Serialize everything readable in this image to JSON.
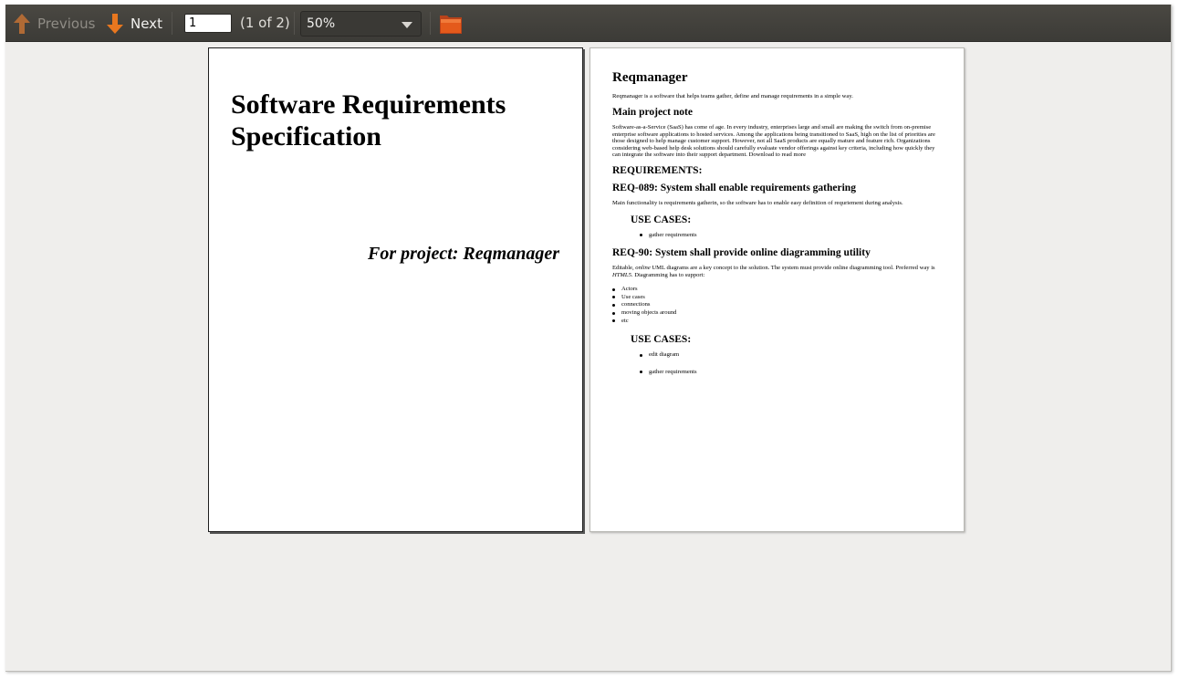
{
  "toolbar": {
    "previous_label": "Previous",
    "next_label": "Next",
    "page_input_value": "1",
    "page_count": "(1 of 2)",
    "zoom_value": "50%",
    "icons": {
      "previous": "up-arrow-icon",
      "next": "down-arrow-icon",
      "open": "folder-icon",
      "zoom": "chevron-down-icon"
    },
    "colors": {
      "arrow": "#e8771f",
      "arrow_disabled": "#b06a35",
      "folder": "#e45a1b"
    }
  },
  "page1": {
    "title": "Software Requirements Specification",
    "subtitle": "For project: Reqmanager"
  },
  "page2": {
    "title": "Reqmanager",
    "intro": "Reqmanager is a software that helps teams gather, define and manage requirements in a simple way.",
    "note_heading": "Main project note",
    "note_text": "Software-as-a-Service (SaaS) has come of age. In every industry, enterprises large and small are making the switch from on-premise enterprise software applications to hosted services. Among the applications being transitioned to SaaS, high on the list of priorities are those designed to help manage customer support. However, not all SaaS products are equally mature and feature rich. Organizations considering web-based help desk solutions should carefully evaluate vendor offerings against key criteria, including how quickly they can integrate the software into their support department. Download to read more",
    "requirements_heading": "REQUIREMENTS:",
    "req1": {
      "title": "REQ-089: System shall enable requirements gathering",
      "text": "Main functionality is requirements gatherin, so the software has to enable easy definition of requriement during analysis.",
      "use_cases_heading": "USE CASES:",
      "use_cases": [
        "gather requirements"
      ]
    },
    "req2": {
      "title": "REQ-90: System shall provide online diagramming utility",
      "text_a": "Editable, ",
      "text_b": "online",
      "text_c": " UML diagrams are a key concept to the solution. The system must provide online diagramming tool. Preferred way is ",
      "text_d": "HTML5",
      "text_e": ". Diagramming has to support:",
      "support_items": [
        "Actors",
        "Use cases",
        "connections",
        "moving objects around",
        "etc"
      ],
      "use_cases_heading": "USE CASES:",
      "use_cases": [
        "edit diagram",
        "gather requirements"
      ]
    }
  }
}
